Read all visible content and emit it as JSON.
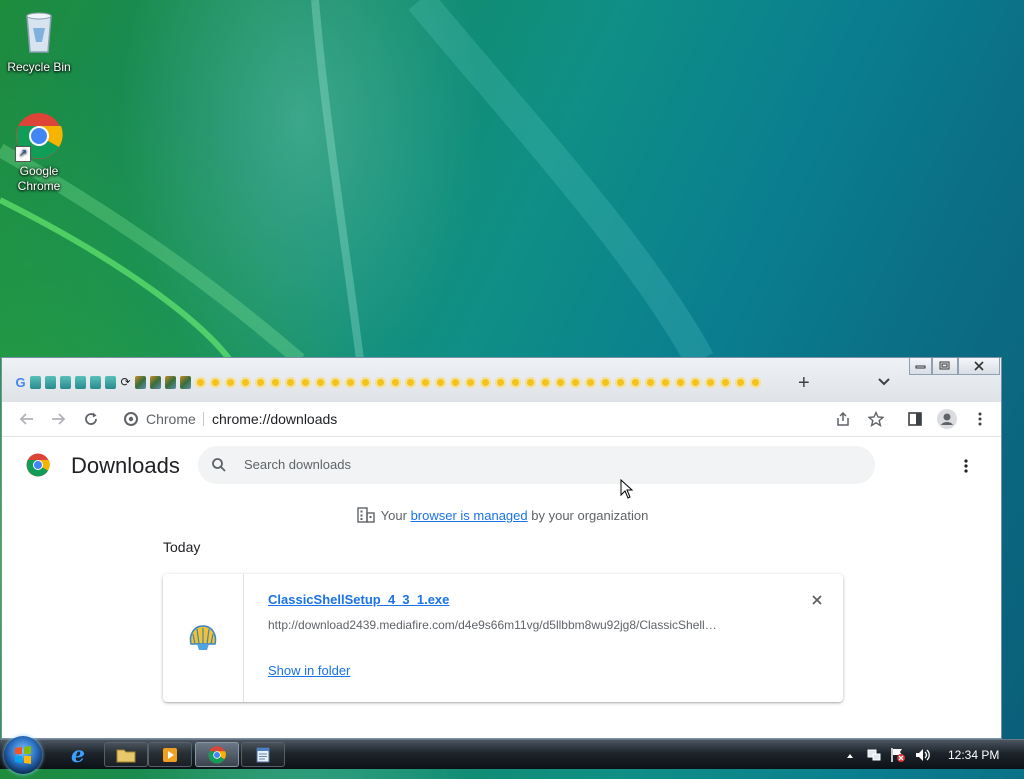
{
  "desktop": {
    "icons": [
      {
        "label": "Recycle Bin",
        "icon": "recycle-bin-icon"
      },
      {
        "label": "Google Chrome",
        "label_line1": "Google",
        "label_line2": "Chrome",
        "icon": "chrome-icon"
      }
    ]
  },
  "browser": {
    "tabs": {
      "new_tab_label": "+",
      "favicons": [
        "google",
        "tablet",
        "tablet",
        "tablet",
        "tablet",
        "tablet",
        "tablet",
        "refresh",
        "photo",
        "photo",
        "photo",
        "photo",
        "sun"
      ],
      "sun_tab_count": 38
    },
    "toolbar": {
      "site_chip": "Chrome",
      "url": "chrome://downloads"
    },
    "page": {
      "title": "Downloads",
      "search_placeholder": "Search downloads",
      "managed_prefix": "Your",
      "managed_link": "browser is managed",
      "managed_suffix": "by your organization",
      "group_label": "Today",
      "download": {
        "filename": "ClassicShellSetup_4_3_1.exe",
        "url": "http://download2439.mediafire.com/d4e9s66m11vg/d5llbbm8wu92jg8/ClassicShell…",
        "show_in_folder": "Show in folder"
      }
    }
  },
  "taskbar": {
    "clock": "12:34 PM",
    "apps": [
      "internet-explorer",
      "file-explorer",
      "media-player",
      "chrome",
      "notepad"
    ],
    "active_app": "chrome"
  },
  "colors": {
    "link": "#1a73e8",
    "window_border": "#7a8fa6",
    "taskbar": "#1d242b"
  }
}
